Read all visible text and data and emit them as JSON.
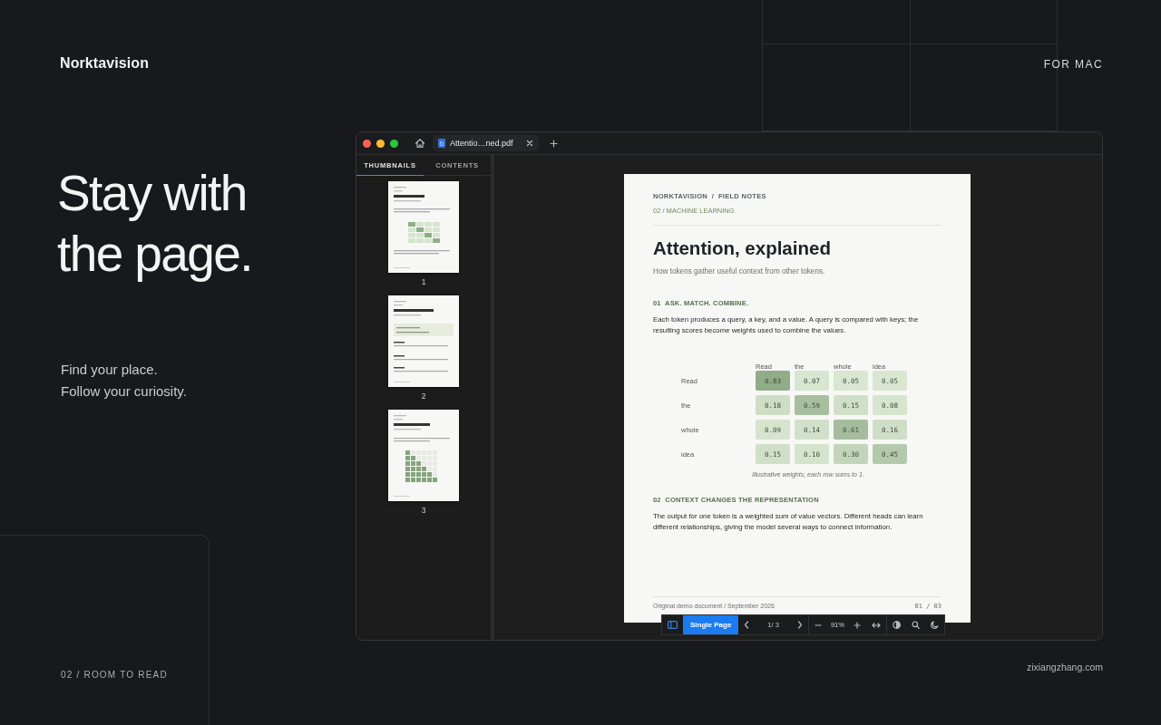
{
  "brand": "Norktavision",
  "platform": "FOR MAC",
  "headline": [
    "Stay with",
    "the page."
  ],
  "taglines": [
    "Find your place.",
    "Follow your curiosity."
  ],
  "section_label": "02 / ROOM TO READ",
  "site": "zixiangzhang.com",
  "viewer": {
    "tab": {
      "title": "Attentio…ned.pdf"
    },
    "sidebar_tabs": [
      {
        "label": "THUMBNAILS",
        "selected": true
      },
      {
        "label": "CONTENTS",
        "selected": false
      }
    ],
    "thumbnails": [
      {
        "kind": "heatmap",
        "page": "1"
      },
      {
        "kind": "code",
        "page": "2"
      },
      {
        "kind": "mask",
        "page": "3"
      }
    ],
    "document": {
      "header": "NORKTAVISION  /  FIELD NOTES",
      "category": "02 / MACHINE LEARNING",
      "title": "Attention, explained",
      "subtitle": "How tokens gather useful context from other tokens.",
      "sections": [
        {
          "heading": "01  ASK. MATCH. COMBINE.",
          "body": "Each token produces a query, a key, and a value. A query is compared with keys; the resulting scores become weights used to combine the values."
        }
      ],
      "heatmap": {
        "columns": [
          "Read",
          "the",
          "whole",
          "idea"
        ],
        "rows": [
          {
            "label": "Read",
            "values": [
              "0.83",
              "0.07",
              "0.05",
              "0.05"
            ]
          },
          {
            "label": "the",
            "values": [
              "0.18",
              "0.59",
              "0.15",
              "0.08"
            ]
          },
          {
            "label": "whole",
            "values": [
              "0.09",
              "0.14",
              "0.61",
              "0.16"
            ]
          },
          {
            "label": "idea",
            "values": [
              "0.15",
              "0.10",
              "0.30",
              "0.45"
            ]
          }
        ],
        "caption": "Illustrative weights; each row sums to 1."
      },
      "sections_after": [
        {
          "heading": "02  CONTEXT CHANGES THE REPRESENTATION",
          "body": "The output for one token is a weighted sum of value vectors. Different heads can learn different relationships, giving the model several ways to connect information."
        }
      ],
      "footer_left": "Original demo document  /  September 2026",
      "footer_right": "01 / 03"
    },
    "toolbar": {
      "view_mode": "Single Page",
      "page": "1/ 3",
      "zoom": "91%"
    }
  }
}
